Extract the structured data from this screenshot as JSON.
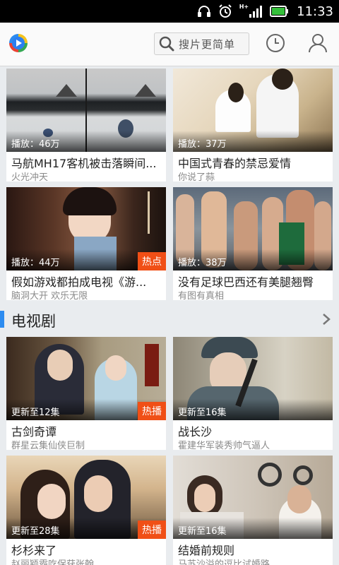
{
  "status_bar": {
    "time": "11:33",
    "network_label": "H+"
  },
  "header": {
    "search_placeholder": "搜片更简单"
  },
  "featured": [
    {
      "title": "马航MH17客机被击落瞬间...",
      "subtitle": "火光冲天",
      "play_count": "播放：46万",
      "tag": ""
    },
    {
      "title": "中国式青春的禁忌爱情",
      "subtitle": "你说了蒜",
      "play_count": "播放：37万",
      "tag": ""
    },
    {
      "title": "假如游戏都拍成电视《游...",
      "subtitle": "脑洞大开 欢乐无限",
      "play_count": "播放：44万",
      "tag": "热点"
    },
    {
      "title": "没有足球巴西还有美腿翘臀",
      "subtitle": "有图有真相",
      "play_count": "播放：38万",
      "tag": ""
    }
  ],
  "tv_section": {
    "title": "电视剧",
    "items": [
      {
        "title": "古剑奇谭",
        "subtitle": "群星云集仙侠巨制",
        "update": "更新至12集",
        "tag": "热播"
      },
      {
        "title": "战长沙",
        "subtitle": "霍建华军装秀帅气逼人",
        "update": "更新至16集",
        "tag": ""
      },
      {
        "title": "杉杉来了",
        "subtitle": "赵丽颖霸吃保获张翰",
        "update": "更新至28集",
        "tag": "热播"
      },
      {
        "title": "结婚前规则",
        "subtitle": "马苏沙溢的逗比试婚路",
        "update": "更新至16集",
        "tag": ""
      }
    ]
  },
  "colors": {
    "accent": "#2d8cf0",
    "hot_tag": "#f04f16",
    "status_bar": "#000000"
  }
}
